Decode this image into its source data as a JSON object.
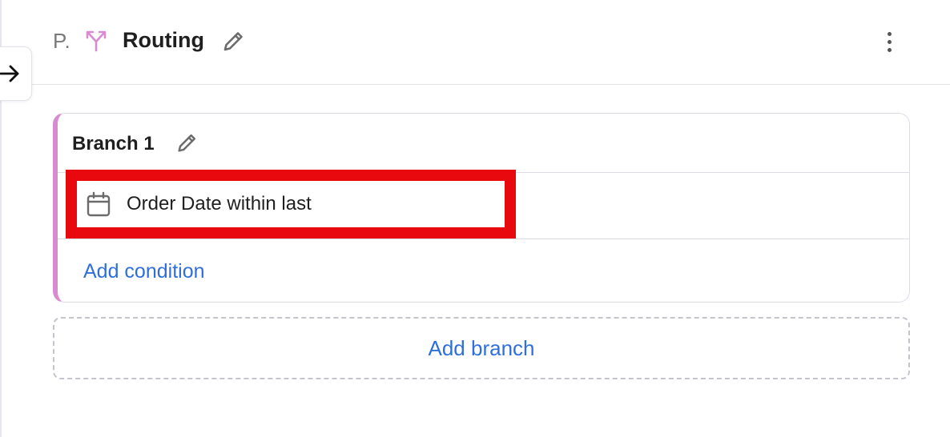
{
  "header": {
    "prefix": "P.",
    "title": "Routing",
    "route_icon": "route-split-icon",
    "edit_icon": "pencil-icon",
    "menu_icon": "more-vertical-icon"
  },
  "sidebar_toggle": {
    "icon": "arrow-right-icon"
  },
  "branch": {
    "title": "Branch 1",
    "edit_icon": "pencil-icon",
    "accent_color": "#d98bd1",
    "conditions": [
      {
        "icon": "calendar-icon",
        "text": "Order Date within last"
      }
    ],
    "add_condition_label": "Add condition"
  },
  "add_branch_label": "Add branch",
  "colors": {
    "link": "#2f6fdc",
    "highlight": "#e8090f",
    "branch_accent": "#d98bd1"
  }
}
